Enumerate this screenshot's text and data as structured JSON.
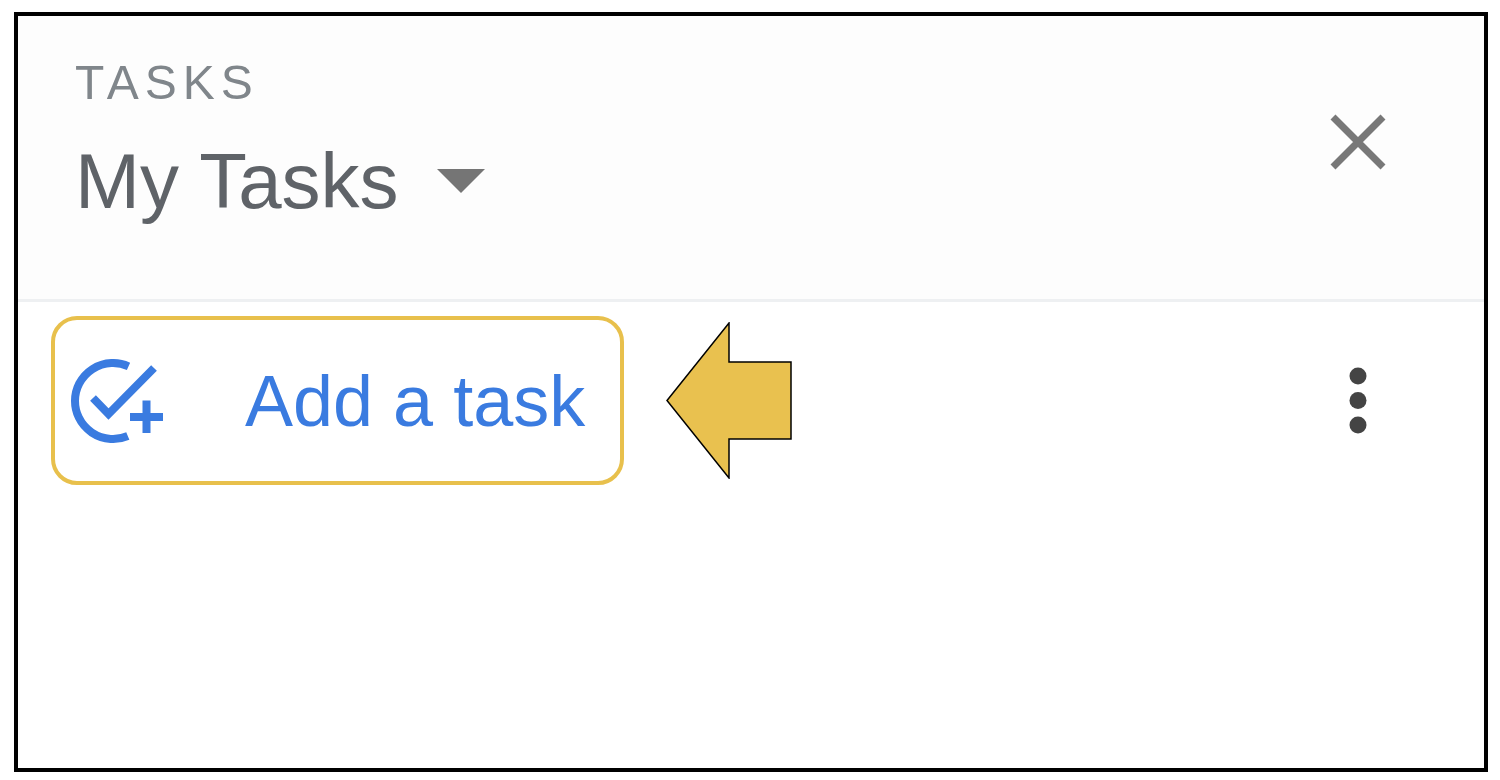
{
  "panel": {
    "eyebrow": "TASKS",
    "title": "My Tasks"
  },
  "add_task": {
    "label": "Add a task",
    "highlighted": true
  }
}
